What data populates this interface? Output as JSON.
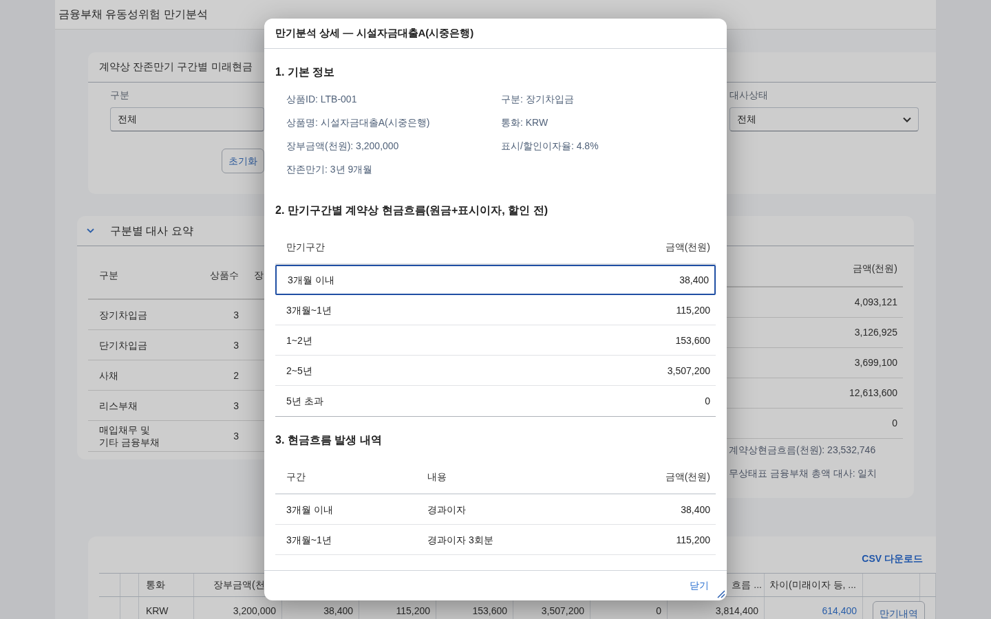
{
  "page": {
    "title": "금융부채 유동성위험 만기분석"
  },
  "filter_panel": {
    "title": "계약상 잔존만기 구간별 미래현금",
    "filters": [
      {
        "label": "구분",
        "value": "전체"
      },
      {
        "label": "대사상태",
        "value": "전체"
      }
    ],
    "reset_button": "초기화"
  },
  "summary_panel": {
    "title": "구분별 대사 요약",
    "expanded": true,
    "columns": [
      "구분",
      "상품수",
      "장"
    ],
    "rows": [
      {
        "category": "장기차입금",
        "count": "3"
      },
      {
        "category": "단기차입금",
        "count": "3"
      },
      {
        "category": "사채",
        "count": "2"
      },
      {
        "category": "리스부채",
        "count": "3"
      },
      {
        "category": "매입채무 및 기타 금융부채",
        "count": "3"
      }
    ]
  },
  "amount_panel": {
    "column": "금액(천원)",
    "values": [
      "4,093,121",
      "3,126,925",
      "3,699,100",
      "12,613,600",
      "0"
    ],
    "totals": [
      "계약상현금흐름(천원): 23,532,746",
      "무상태표 금융부채 총액 대사: 일치"
    ]
  },
  "detail_table": {
    "download_link": "CSV 다운로드",
    "columns": [
      "통화",
      "장부금액(천",
      "",
      "",
      "",
      "",
      "",
      "흐름 ...",
      "차이(미래이자 등, ..."
    ],
    "rows": [
      {
        "cells": [
          "KRW",
          "3,200,000",
          "38,400",
          "115,200",
          "153,600",
          "3,507,200",
          "0",
          "3,814,400",
          "614,400"
        ],
        "action": "만기내역"
      }
    ]
  },
  "dialog": {
    "title": "만기분석 상세 — 시설자금대출A(시중은행)",
    "sections": [
      {
        "kind": "info",
        "heading": "1. 기본 정보",
        "items": [
          "상품ID: LTB-001",
          "구분: 장기차입금",
          "상품명: 시설자금대출A(시중은행)",
          "통화: KRW",
          "장부금액(천원): 3,200,000",
          "표시/할인이자율: 4.8%",
          "잔존만기: 3년 9개월"
        ]
      },
      {
        "kind": "table",
        "heading": "2. 만기구간별 계약상 현금흐름(원금+표시이자, 할인 전)",
        "columns": [
          "만기구간",
          "금액(천원)"
        ],
        "rows": [
          {
            "cells": [
              "3개월 이내",
              "38,400"
            ],
            "selected": true
          },
          {
            "cells": [
              "3개월~1년",
              "115,200"
            ],
            "selected": false
          },
          {
            "cells": [
              "1~2년",
              "153,600"
            ],
            "selected": false
          },
          {
            "cells": [
              "2~5년",
              "3,507,200"
            ],
            "selected": false
          },
          {
            "cells": [
              "5년 초과",
              "0"
            ],
            "selected": false
          }
        ]
      },
      {
        "kind": "table",
        "heading": "3. 현금흐름 발생 내역",
        "columns": [
          "구간",
          "내용",
          "금액(천원)"
        ],
        "rows": [
          {
            "cells": [
              "3개월 이내",
              "경과이자",
              "38,400"
            ],
            "selected": false
          },
          {
            "cells": [
              "3개월~1년",
              "경과이자 3회분",
              "115,200"
            ],
            "selected": false
          }
        ]
      }
    ],
    "close_button": "닫기"
  }
}
